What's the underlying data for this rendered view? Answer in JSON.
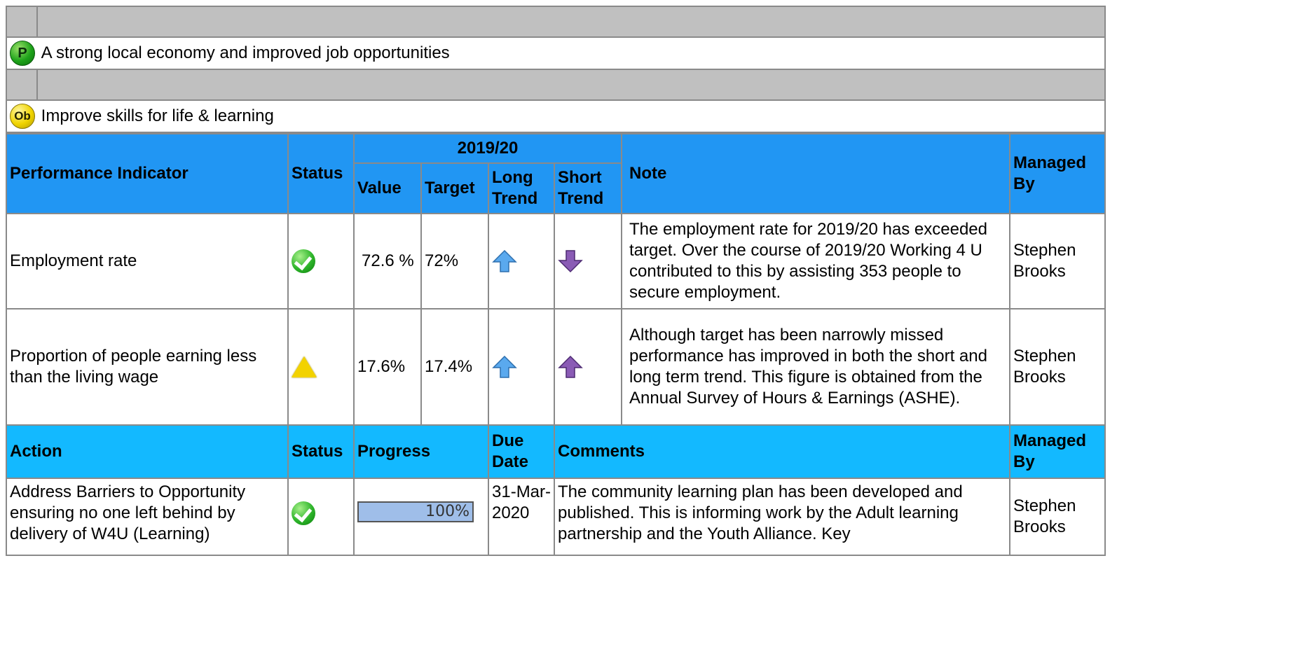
{
  "sections": {
    "priority": {
      "badge": "P",
      "label": "A strong local economy and improved job opportunities"
    },
    "objective": {
      "badge": "Ob",
      "label": "Improve skills for life & learning"
    }
  },
  "pi_table": {
    "headers": {
      "indicator": "Performance Indicator",
      "status": "Status",
      "period": "2019/20",
      "value": "Value",
      "target": "Target",
      "long_trend": "Long Trend",
      "short_trend": "Short Trend",
      "note": "Note",
      "managed_by": "Managed By"
    },
    "rows": [
      {
        "indicator": "Employment rate",
        "status_icon": "green-check-icon",
        "value": "72.6 %",
        "target": "72%",
        "long_trend_icon": "blue-up-arrow-icon",
        "short_trend_icon": "purple-down-arrow-icon",
        "note": "The employment rate for 2019/20 has exceeded target. Over the course of 2019/20 Working 4 U contributed to this by assisting 353 people to secure employment.",
        "managed_by": "Stephen Brooks"
      },
      {
        "indicator": "Proportion of people earning less than the living wage",
        "status_icon": "amber-warning-icon",
        "value": "17.6%",
        "target": "17.4%",
        "long_trend_icon": "blue-up-arrow-icon",
        "short_trend_icon": "purple-up-arrow-icon",
        "note": "Although target has been narrowly missed performance has improved in both the short and long term trend. This figure is obtained from the Annual Survey of Hours & Earnings (ASHE).",
        "managed_by": "Stephen Brooks"
      }
    ]
  },
  "action_table": {
    "headers": {
      "action": "Action",
      "status": "Status",
      "progress": "Progress",
      "due_date": "Due Date",
      "comments": "Comments",
      "managed_by": "Managed By"
    },
    "rows": [
      {
        "action": "Address Barriers to Opportunity ensuring no one left behind by delivery of  W4U (Learning)",
        "status_icon": "green-check-icon",
        "progress_label": "100%",
        "progress_value": 1.0,
        "due_date": "31-Mar-2020",
        "comments": "The community learning plan has been developed and published. This is informing work by the Adult learning partnership and the Youth Alliance. Key",
        "managed_by": "Stephen Brooks"
      }
    ]
  },
  "colors": {
    "header_grey": "#c0c0c0",
    "pi_header_blue": "#2196f3",
    "action_header_blue": "#13b9ff",
    "grid": "#8a8a8a"
  }
}
